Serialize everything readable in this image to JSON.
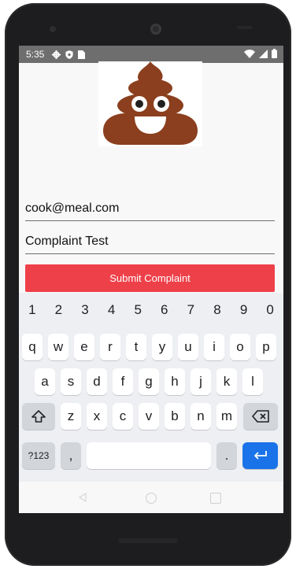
{
  "status_bar": {
    "time": "5:35"
  },
  "form": {
    "email_value": "cook@meal.com",
    "complaint_value": "Complaint Test",
    "submit_label": "Submit Complaint"
  },
  "keyboard": {
    "number_row": [
      "1",
      "2",
      "3",
      "4",
      "5",
      "6",
      "7",
      "8",
      "9",
      "0"
    ],
    "row1": [
      "q",
      "w",
      "e",
      "r",
      "t",
      "y",
      "u",
      "i",
      "o",
      "p"
    ],
    "row2": [
      "a",
      "s",
      "d",
      "f",
      "g",
      "h",
      "j",
      "k",
      "l"
    ],
    "row3": [
      "z",
      "x",
      "c",
      "v",
      "b",
      "n",
      "m"
    ],
    "symbols_label": "?123",
    "comma": ",",
    "period": "."
  },
  "colors": {
    "submit": "#ee4049",
    "status_bar": "#6e6e6e",
    "enter_key": "#1a73e8",
    "logo_brown": "#8b3f1e"
  }
}
